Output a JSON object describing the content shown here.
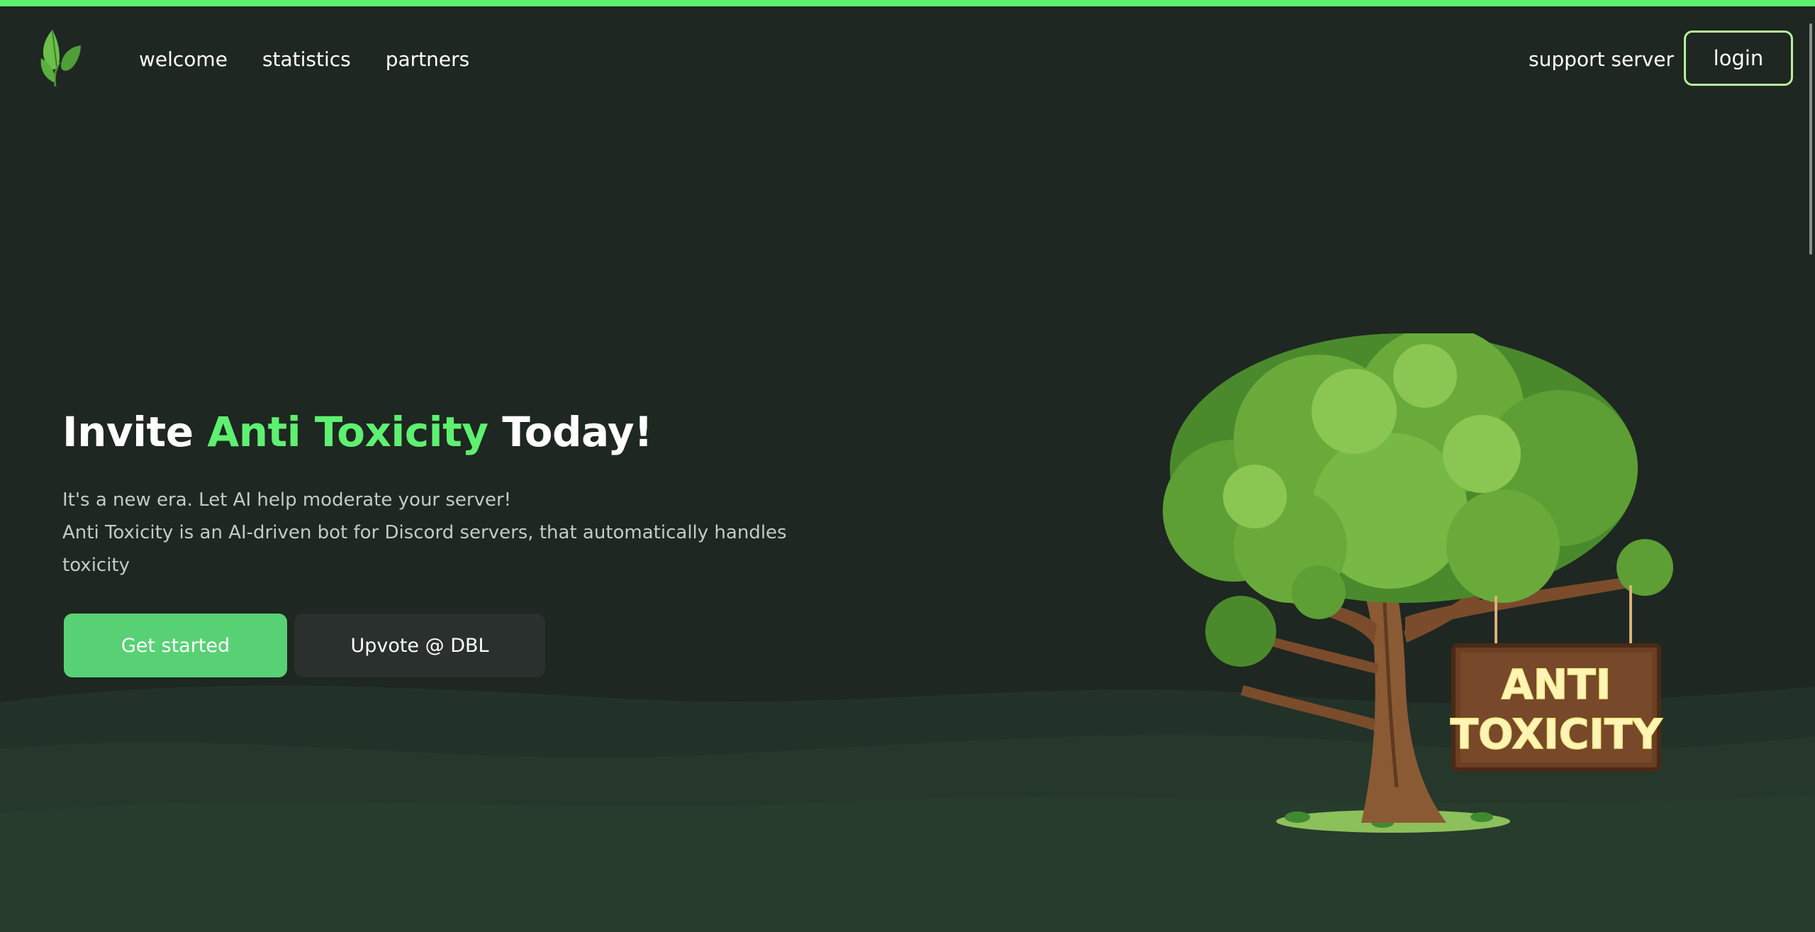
{
  "nav": {
    "items": [
      {
        "label": "welcome"
      },
      {
        "label": "statistics"
      },
      {
        "label": "partners"
      }
    ],
    "support_label": "support server",
    "login_label": "login"
  },
  "hero": {
    "title_prefix": "Invite ",
    "title_accent": "Anti Toxicity",
    "title_suffix": " Today!",
    "line1": "It's a new era. Let AI help moderate your server!",
    "line2": "Anti Toxicity is an AI-driven bot for Discord servers, that automatically handles toxicity",
    "primary_button": "Get started",
    "secondary_button": "Upvote @ DBL"
  },
  "sign": {
    "line1": "ANTI",
    "line2": "TOXICITY"
  },
  "icons": {
    "logo": "leaf-logo-icon"
  },
  "colors": {
    "background": "#1e2721",
    "accent": "#5ef070",
    "primary_button": "#58d175",
    "secondary_button": "#2a302d",
    "login_border": "#b6ef9a"
  }
}
